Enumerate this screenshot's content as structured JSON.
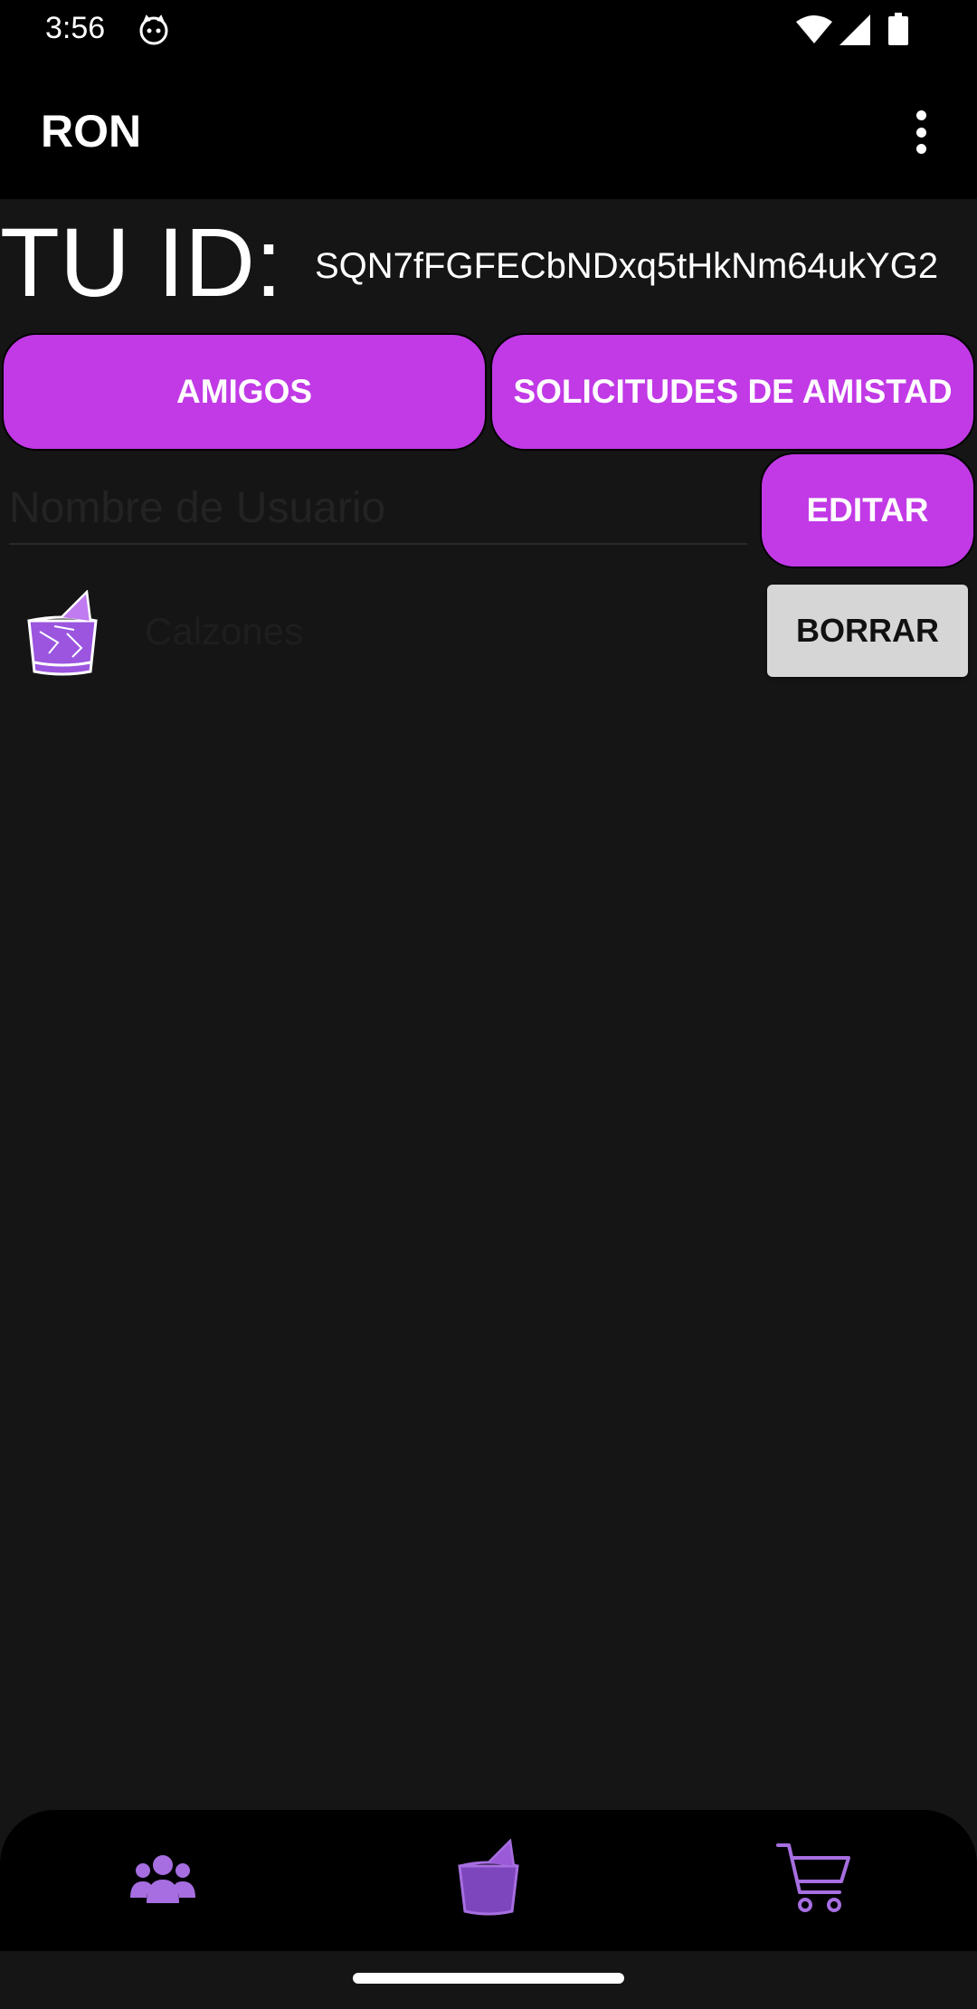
{
  "status_bar": {
    "time": "3:56",
    "icons": [
      "cat-notification-icon",
      "wifi-icon",
      "signal-icon",
      "battery-icon"
    ]
  },
  "app_bar": {
    "title": "RON",
    "menu_icon": "more-vert-icon"
  },
  "profile": {
    "id_label": "TU ID:",
    "id_value": "SQN7fFGFECbNDxq5tHkNm64ukYG2"
  },
  "buttons": {
    "friends": "AMIGOS",
    "requests": "SOLICITUDES DE AMISTAD",
    "edit": "EDITAR"
  },
  "username_field": {
    "placeholder": "Nombre de Usuario",
    "value": ""
  },
  "list": {
    "items": [
      {
        "name": "Calzones",
        "icon": "drink-glass-icon",
        "action": "BORRAR"
      }
    ]
  },
  "bottom_nav": {
    "items": [
      {
        "icon": "group-icon"
      },
      {
        "icon": "drink-glass-icon"
      },
      {
        "icon": "shopping-cart-icon"
      }
    ]
  },
  "colors": {
    "accent": "#c13ae6",
    "nav_icon": "#a66ee0",
    "background": "#151515",
    "bar": "#000000"
  }
}
